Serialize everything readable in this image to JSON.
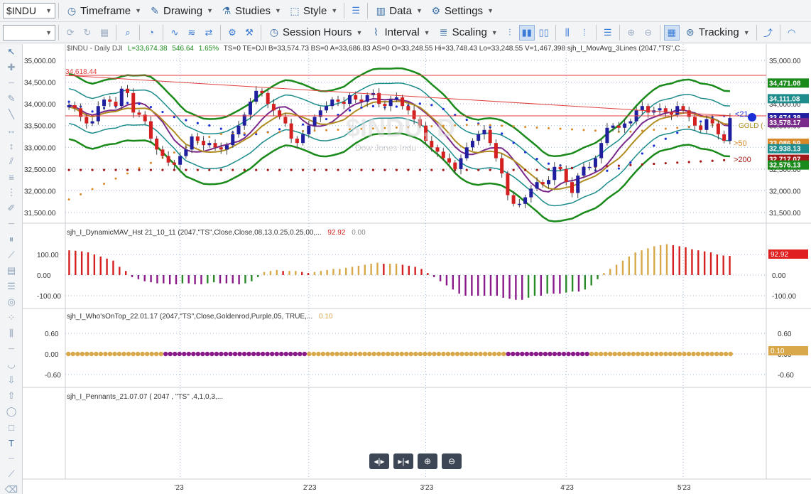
{
  "toolbar": {
    "symbol": "$INDU",
    "timeframe_label": "Timeframe",
    "drawing_label": "Drawing",
    "studies_label": "Studies",
    "style_label": "Style",
    "data_label": "Data",
    "settings_label": "Settings",
    "session_hours_label": "Session Hours",
    "interval_label": "Interval",
    "scaling_label": "Scaling",
    "tracking_label": "Tracking"
  },
  "header": {
    "symbol_info": "$INDU - Daily  DJI",
    "last": "L=33,674.38",
    "change": "546.64",
    "change_pct": "1.65%",
    "rest": "TS=0  TE=DJI  B=33,574.73  BS=0  A=33,686.83  AS=0  O=33,248.55  Hi=33,748.43  Lo=33,248.55  V=1,467,398  sjh_I_MovAvg_3Lines (2047,\"TS\",C...",
    "watermark": "$INDU, D",
    "watermark_sub": "Dow Jones Indu"
  },
  "colors": {
    "up": "#1f1f9f",
    "down": "#d42020",
    "green_band": "#1a8a1a",
    "teal_band": "#1e8c8c",
    "ma_fast": "#7a2a8a",
    "ma_gold": "#b08d20",
    "dots_fast": "#1b2fd6",
    "dots_mid": "#d8892a",
    "dots_slow": "#a31818",
    "hist_red": "#d42020",
    "hist_gold": "#d8a84a",
    "hist_purple": "#8a1a8a",
    "hist_green": "#2a8a2a"
  },
  "price_panel": {
    "y_ticks": [
      "35,000.00",
      "34,500.00",
      "34,000.00",
      "33,500.00",
      "33,000.00",
      "32,500.00",
      "32,000.00",
      "31,500.00"
    ],
    "y_values": [
      35000,
      34500,
      34000,
      33500,
      33000,
      32500,
      32000,
      31500
    ],
    "resistance_label": "34,618.44",
    "resistance_value": 34618.44,
    "labels": [
      {
        "text": "34,471.08",
        "value": 34471.08,
        "color": "#1a8a1a"
      },
      {
        "text": "34,111.08",
        "value": 34111.08,
        "color": "#1e8c8c"
      },
      {
        "text": "33,674.38",
        "value": 33674.38,
        "color": "#1f1f9f"
      },
      {
        "text": "33,578.17",
        "value": 33560,
        "color": "#7a2a8a"
      },
      {
        "text": "33,086.59",
        "value": 33086.59,
        "color": "#d8892a"
      },
      {
        "text": "32,938.13",
        "value": 32960,
        "color": "#1e8c8c"
      },
      {
        "text": "32,717.07",
        "value": 32717.07,
        "color": "#a31818"
      },
      {
        "text": "32,576.13",
        "value": 32585,
        "color": "#1a8a1a"
      }
    ],
    "annot_21": "<21",
    "annot_gold": "GOLD (",
    "annot_50": ">50",
    "annot_200": ">200"
  },
  "hist_panel": {
    "title": "sjh_I_DynamicMAV_Hst 21_10_11 (2047,\"TS\",Close,Close,08,13,0.25,0.25,00,...",
    "value1": "92.92",
    "value2": "0.00",
    "y_ticks": [
      "100.00",
      "0.00",
      "-100.00"
    ],
    "y_values": [
      100,
      0,
      -100
    ],
    "badge": "92.92"
  },
  "who_panel": {
    "title": "sjh_I_Who'sOnTop_22.01.17 (2047,\"TS\",Close,Goldenrod,Purple,05, TRUE,...",
    "value": "0.10",
    "y_ticks": [
      "0.60",
      "0.00",
      "-0.60"
    ],
    "y_values": [
      0.6,
      0,
      -0.6
    ],
    "badge": "0.10"
  },
  "pennants_panel": {
    "title": "sjh_I_Pennants_21.07.07 ( 2047 , \"TS\" ,4,1,0,3,..."
  },
  "x_axis": {
    "labels": [
      "'23",
      "2'23",
      "3'23",
      "4'23",
      "5'23"
    ]
  },
  "chart_data": {
    "type": "candlestick",
    "title": "$INDU - Daily",
    "closes": [
      33970,
      33900,
      33700,
      33550,
      33600,
      33950,
      34100,
      34050,
      33950,
      34350,
      34250,
      33800,
      33750,
      33600,
      33200,
      32950,
      32800,
      32650,
      32600,
      32800,
      32950,
      33250,
      33150,
      33050,
      33100,
      33000,
      32950,
      33050,
      33300,
      33500,
      33750,
      34050,
      34300,
      34250,
      34000,
      33850,
      33700,
      33550,
      33200,
      33100,
      33300,
      33500,
      33700,
      33850,
      33950,
      34100,
      34050,
      34000,
      34200,
      34100,
      34050,
      34200,
      34250,
      34000,
      33950,
      34100,
      34150,
      33950,
      33850,
      33650,
      33500,
      33150,
      33000,
      32900,
      32750,
      32650,
      32500,
      32750,
      33000,
      33150,
      33300,
      33400,
      33100,
      32750,
      32400,
      31900,
      31700,
      31700,
      31850,
      32050,
      32200,
      32150,
      32250,
      32550,
      32500,
      32200,
      31950,
      32350,
      32550,
      32550,
      32750,
      33100,
      33450,
      33500,
      33450,
      33550,
      33600,
      33850,
      33950,
      33800,
      33850,
      33900,
      33800,
      33750,
      33950,
      33850,
      33700,
      33500,
      33400,
      33650,
      33550,
      33300,
      33150,
      33674
    ],
    "hist": [
      120,
      118,
      115,
      110,
      100,
      90,
      80,
      70,
      40,
      20,
      -10,
      -20,
      -30,
      -35,
      -40,
      -40,
      -45,
      -45,
      -40,
      -40,
      -45,
      -45,
      -40,
      -35,
      -40,
      -40,
      -40,
      -45,
      -40,
      -30,
      -10,
      15,
      20,
      25,
      20,
      20,
      20,
      15,
      10,
      15,
      20,
      25,
      30,
      30,
      35,
      40,
      45,
      50,
      55,
      60,
      55,
      55,
      55,
      50,
      45,
      40,
      30,
      10,
      -10,
      -30,
      -50,
      -70,
      -90,
      -100,
      -100,
      -100,
      -100,
      -100,
      -100,
      -110,
      -115,
      -120,
      -120,
      -110,
      -100,
      -100,
      -90,
      -90,
      -90,
      -85,
      -80,
      -80,
      -70,
      -50,
      -20,
      10,
      30,
      50,
      70,
      90,
      110,
      120,
      130,
      140,
      145,
      150,
      145,
      140,
      135,
      125,
      120,
      115,
      110,
      100,
      95,
      92.92
    ],
    "who": [
      "g",
      "g",
      "g",
      "g",
      "g",
      "g",
      "g",
      "g",
      "g",
      "g",
      "g",
      "g",
      "g",
      "g",
      "g",
      "g",
      "g",
      "g",
      "g",
      "g",
      "g",
      "p",
      "p",
      "p",
      "p",
      "p",
      "p",
      "p",
      "p",
      "p",
      "p",
      "p",
      "p",
      "p",
      "p",
      "p",
      "p",
      "p",
      "p",
      "p",
      "p",
      "p",
      "p",
      "p",
      "p",
      "p",
      "p",
      "p",
      "p",
      "p",
      "p",
      "p",
      "g",
      "g",
      "g",
      "g",
      "g",
      "g",
      "g",
      "g",
      "g",
      "g",
      "g",
      "g",
      "g",
      "g",
      "g",
      "g",
      "g",
      "g",
      "g",
      "g",
      "g",
      "g",
      "g",
      "g",
      "g",
      "g",
      "g",
      "g",
      "g",
      "g",
      "g",
      "g",
      "g",
      "g",
      "g",
      "g",
      "g",
      "g",
      "g",
      "g",
      "g",
      "g",
      "g",
      "p",
      "p",
      "p",
      "p",
      "p",
      "p",
      "p",
      "p",
      "p",
      "p",
      "p",
      "p",
      "p",
      "p",
      "p",
      "p",
      "p",
      "p",
      "g",
      "g",
      "g",
      "g",
      "g",
      "g",
      "g",
      "g",
      "g",
      "g",
      "g",
      "g",
      "g",
      "g",
      "g",
      "g",
      "g",
      "g",
      "g",
      "g",
      "g",
      "g",
      "g",
      "g",
      "g",
      "g",
      "g",
      "g",
      "g",
      "g",
      "g"
    ]
  }
}
